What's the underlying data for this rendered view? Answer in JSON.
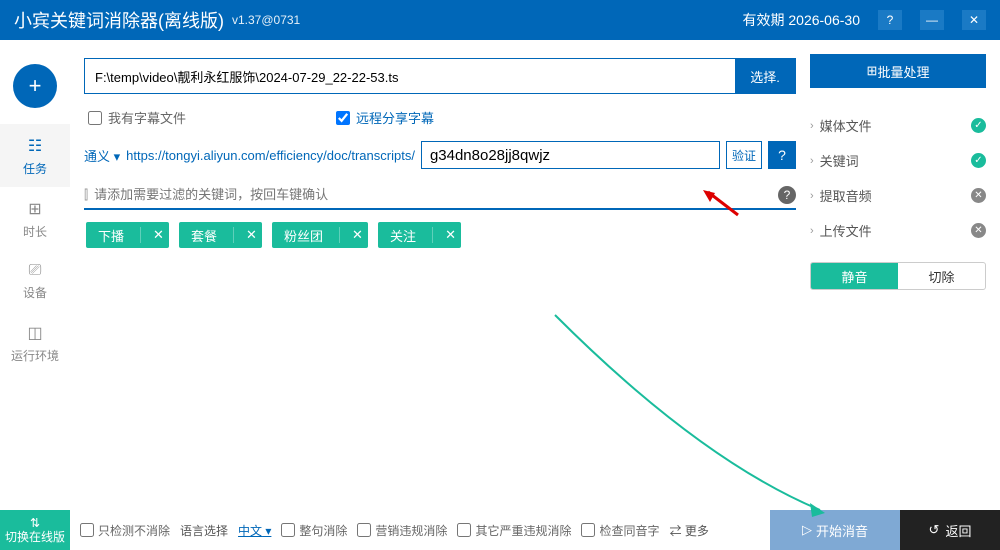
{
  "titlebar": {
    "title": "小宾关键词消除器(离线版)",
    "version": "v1.37@0731",
    "expiry_label": "有效期",
    "expiry_date": "2026-06-30"
  },
  "sidebar": {
    "items": [
      {
        "label": "任务"
      },
      {
        "label": "时长"
      },
      {
        "label": "设备"
      },
      {
        "label": "运行环境"
      }
    ]
  },
  "main": {
    "file_path": "F:\\temp\\video\\靓利永红服饰\\2024-07-29_22-22-53.ts",
    "select_btn": "选择.",
    "have_subtitle": "我有字幕文件",
    "remote_share": "远程分享字幕",
    "source": "通义",
    "transcript_url": "https://tongyi.aliyun.com/efficiency/doc/transcripts/",
    "code": "g34dn8o28jj8qwjz",
    "verify_btn": "验证",
    "keyword_placeholder": "请添加需要过滤的关键词，按回车键确认",
    "tags": [
      "下播",
      "套餐",
      "粉丝团",
      "关注"
    ]
  },
  "right": {
    "batch_btn": "批量处理",
    "steps": [
      {
        "label": "媒体文件",
        "status": "ok"
      },
      {
        "label": "关键词",
        "status": "ok"
      },
      {
        "label": "提取音频",
        "status": "no"
      },
      {
        "label": "上传文件",
        "status": "no"
      }
    ],
    "mode_mute": "静音",
    "mode_cut": "切除"
  },
  "footer": {
    "switch_online": "切换在线版",
    "opts": {
      "detect_only": "只检测不消除",
      "lang_label": "语言选择",
      "lang_value": "中文",
      "whole_sentence": "整句消除",
      "marketing": "营销违规消除",
      "other_serious": "其它严重违规消除",
      "homophone": "检查同音字",
      "more": "更多"
    },
    "start_btn": "开始消音",
    "back_btn": "返回"
  }
}
